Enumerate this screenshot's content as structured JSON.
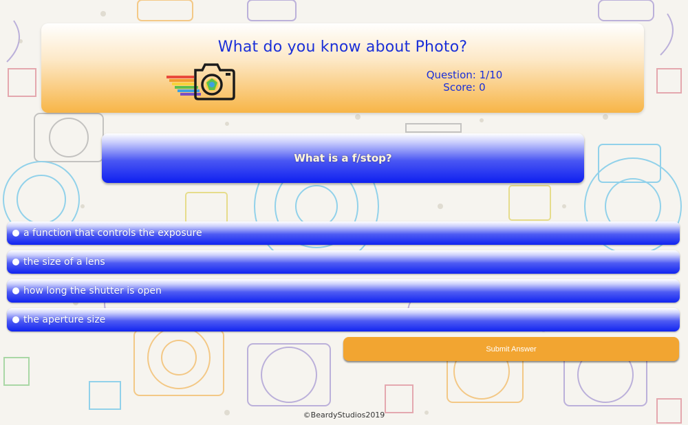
{
  "header": {
    "title": "What do you know about Photo?",
    "logo_icon": "rainbow-camera-icon",
    "question_counter": "Question: 1/10",
    "score": "Score: 0"
  },
  "question": {
    "text": "What is a f/stop?"
  },
  "options": [
    {
      "label": "a function that controls the exposure"
    },
    {
      "label": "the size of a lens"
    },
    {
      "label": "how long the shutter is open"
    },
    {
      "label": "the aperture size"
    }
  ],
  "submit": {
    "label": "Submit Answer"
  },
  "footer": {
    "copyright": "©BeardyStudios2019"
  },
  "colors": {
    "title_blue": "#1a2fd8",
    "option_blue": "#1124f0",
    "submit_orange": "#f2a531",
    "header_orange": "#f7b547"
  }
}
